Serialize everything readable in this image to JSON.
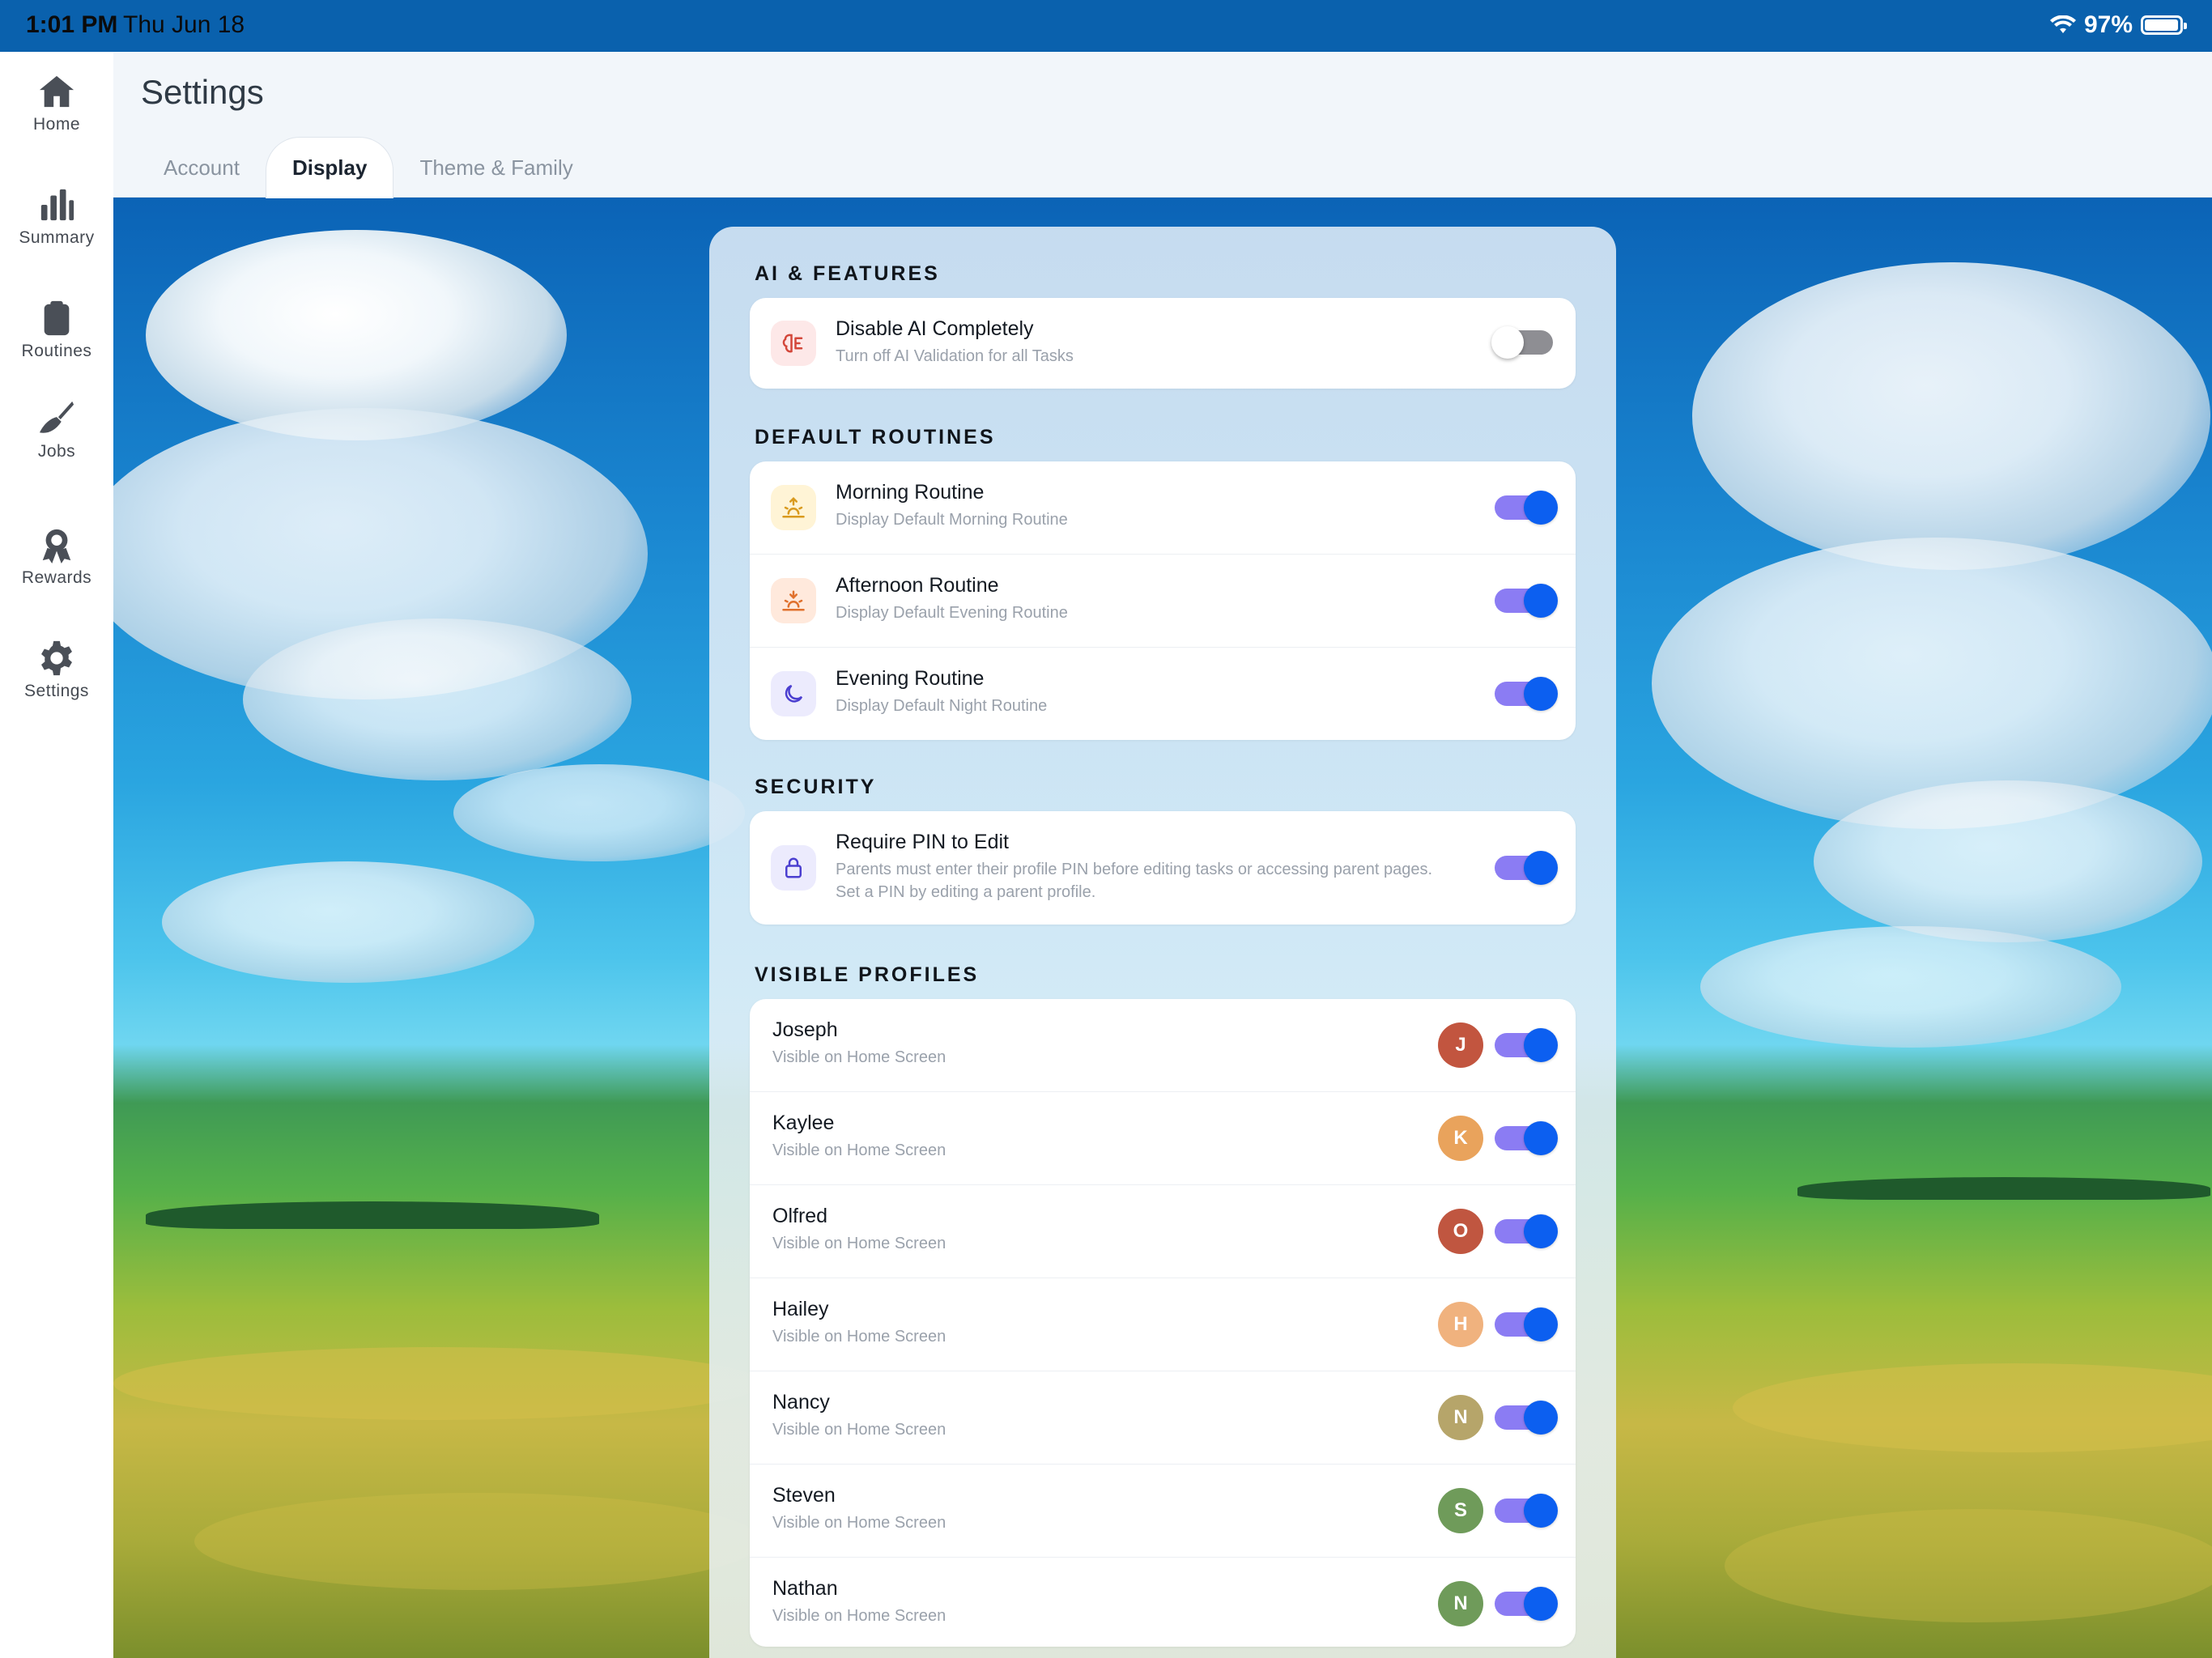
{
  "status_bar": {
    "time": "1:01 PM",
    "date": "Thu Jun 18",
    "battery": "97%",
    "battery_level": 0.97
  },
  "sidebar": {
    "items": [
      {
        "label": "Home",
        "icon": "home-icon"
      },
      {
        "label": "Summary",
        "icon": "bar-chart-icon"
      },
      {
        "label": "Routines",
        "icon": "clipboard-icon"
      },
      {
        "label": "Jobs",
        "icon": "broom-icon"
      },
      {
        "label": "Rewards",
        "icon": "award-icon"
      },
      {
        "label": "Settings",
        "icon": "gear-icon"
      }
    ]
  },
  "header": {
    "title": "Settings",
    "tabs": [
      {
        "label": "Account",
        "active": false
      },
      {
        "label": "Display",
        "active": true
      },
      {
        "label": "Theme & Family",
        "active": false
      }
    ]
  },
  "sections": {
    "ai": {
      "title": "AI & FEATURES",
      "rows": [
        {
          "title": "Disable AI Completely",
          "subtitle": "Turn off AI Validation for all Tasks",
          "icon": "ai-brain-icon",
          "enabled": false
        }
      ]
    },
    "routines": {
      "title": "DEFAULT ROUTINES",
      "rows": [
        {
          "title": "Morning Routine",
          "subtitle": "Display Default Morning Routine",
          "icon": "sunrise-icon",
          "enabled": true
        },
        {
          "title": "Afternoon Routine",
          "subtitle": "Display Default Evening Routine",
          "icon": "sunset-icon",
          "enabled": true
        },
        {
          "title": "Evening Routine",
          "subtitle": "Display Default Night Routine",
          "icon": "moon-icon",
          "enabled": true
        }
      ]
    },
    "security": {
      "title": "SECURITY",
      "rows": [
        {
          "title": "Require PIN to Edit",
          "subtitle_line1": "Parents must enter their profile PIN before editing tasks or accessing parent pages.",
          "subtitle_line2": "Set a PIN by editing a parent profile.",
          "icon": "lock-icon",
          "enabled": true
        }
      ]
    },
    "profiles": {
      "title": "VISIBLE PROFILES",
      "rows": [
        {
          "name": "Joseph",
          "subtitle": "Visible on Home Screen",
          "initial": "J",
          "color": "#c2553f",
          "enabled": true
        },
        {
          "name": "Kaylee",
          "subtitle": "Visible on Home Screen",
          "initial": "K",
          "color": "#e9a35c",
          "enabled": true
        },
        {
          "name": "Olfred",
          "subtitle": "Visible on Home Screen",
          "initial": "O",
          "color": "#c05640",
          "enabled": true
        },
        {
          "name": "Hailey",
          "subtitle": "Visible on Home Screen",
          "initial": "H",
          "color": "#f0b27e",
          "enabled": true
        },
        {
          "name": "Nancy",
          "subtitle": "Visible on Home Screen",
          "initial": "N",
          "color": "#b6a56a",
          "enabled": true
        },
        {
          "name": "Steven",
          "subtitle": "Visible on Home Screen",
          "initial": "S",
          "color": "#6f9b5a",
          "enabled": true
        },
        {
          "name": "Nathan",
          "subtitle": "Visible on Home Screen",
          "initial": "N",
          "color": "#6f9b5a",
          "enabled": true
        }
      ]
    }
  },
  "colors": {
    "accent": "#0c5ff0",
    "toggle_track": "#8b7cf3"
  }
}
